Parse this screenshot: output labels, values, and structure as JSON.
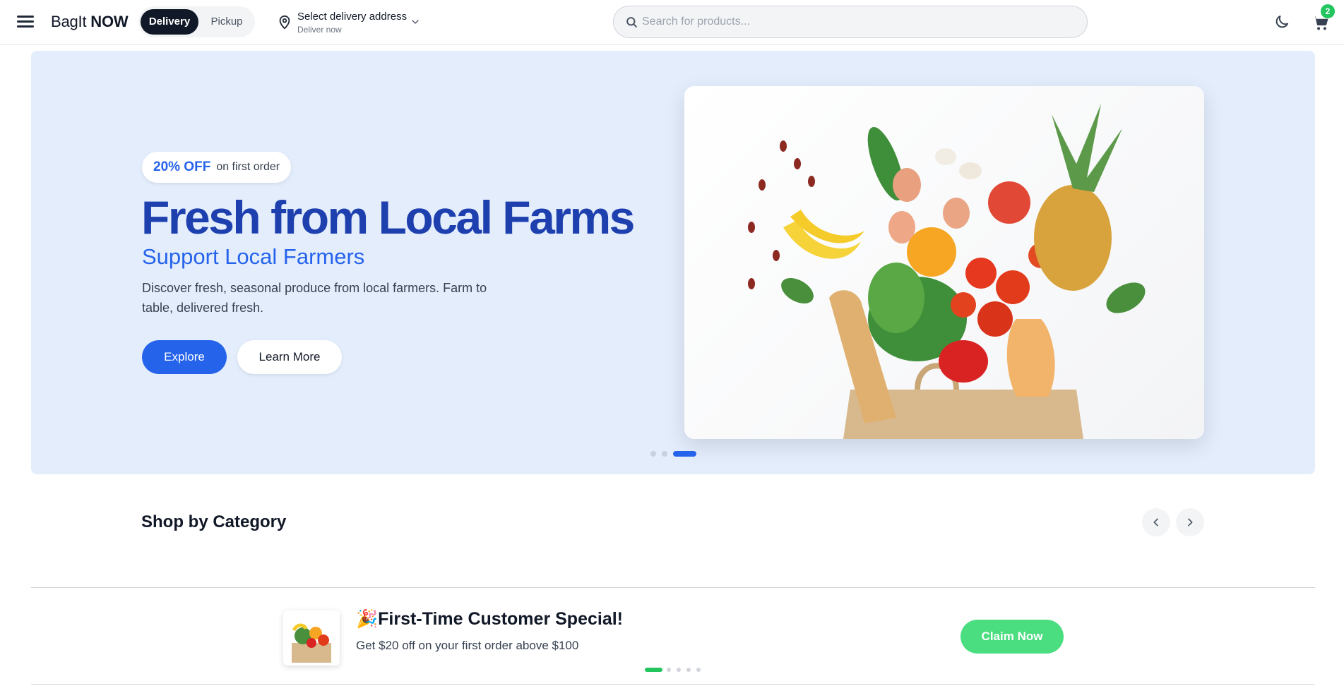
{
  "header": {
    "logo_prefix": "BagIt",
    "logo_suffix": "NOW",
    "modes": {
      "delivery": "Delivery",
      "pickup": "Pickup"
    },
    "address": {
      "title": "Select delivery address",
      "subtitle": "Deliver now"
    },
    "search": {
      "placeholder": "Search for products...",
      "value": ""
    },
    "cart": {
      "count": "2"
    }
  },
  "hero": {
    "promo_strong": "20% OFF",
    "promo_rest": "on first order",
    "title": "Fresh from Local Farms",
    "subtitle": "Support Local Farmers",
    "description": "Discover fresh, seasonal produce from local farmers. Farm to table, delivered fresh.",
    "primary_button": "Explore",
    "secondary_button": "Learn More",
    "slides": 3,
    "active_slide": 3
  },
  "categories": {
    "title": "Shop by Category"
  },
  "banner": {
    "emoji": "🎉",
    "title": "First-Time Customer Special!",
    "description": "Get $20 off on your first order above $100",
    "button": "Claim Now",
    "slides": 5,
    "active_slide": 1
  },
  "colors": {
    "primary": "#2563eb",
    "heading": "#1e40af",
    "hero_bg": "#e3edfc",
    "accent_green": "#4ade80",
    "badge_green": "#22c55e"
  }
}
